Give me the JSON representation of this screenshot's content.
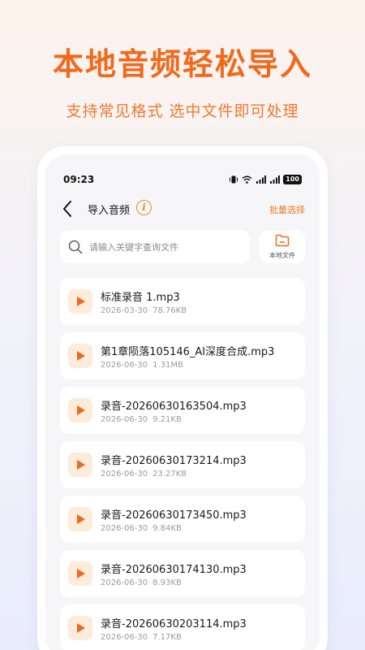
{
  "promo": {
    "headline": "本地音频轻松导入",
    "subline": "支持常见格式  选中文件即可处理"
  },
  "status": {
    "time": "09:23",
    "battery": "100",
    "icons": [
      "vibrate-icon",
      "wifi-icon",
      "signal-icon",
      "signal-icon"
    ]
  },
  "nav": {
    "title": "导入音频",
    "info_icon": "info-icon",
    "batch_label": "批量选择"
  },
  "search": {
    "placeholder": "请输入关键字查询文件",
    "value": ""
  },
  "local_file": {
    "label": "本地文件",
    "icon": "folder-icon"
  },
  "files": [
    {
      "name": "标准录音 1.mp3",
      "date": "2026-03-30",
      "size": "78.76KB"
    },
    {
      "name": "第1章陨落105146_AI深度合成.mp3",
      "date": "2026-06-30",
      "size": "1.31MB"
    },
    {
      "name": "录音-20260630163504.mp3",
      "date": "2026-06-30",
      "size": "9.21KB"
    },
    {
      "name": "录音-20260630173214.mp3",
      "date": "2026-06-30",
      "size": "23.27KB"
    },
    {
      "name": "录音-20260630173450.mp3",
      "date": "2026-06-30",
      "size": "9.84KB"
    },
    {
      "name": "录音-20260630174130.mp3",
      "date": "2026-06-30",
      "size": "8.93KB"
    },
    {
      "name": "录音-20260630203114.mp3",
      "date": "2026-06-30",
      "size": "7.17KB"
    }
  ],
  "colors": {
    "accent": "#f06a1e",
    "play_bg": "#fdebdc"
  }
}
